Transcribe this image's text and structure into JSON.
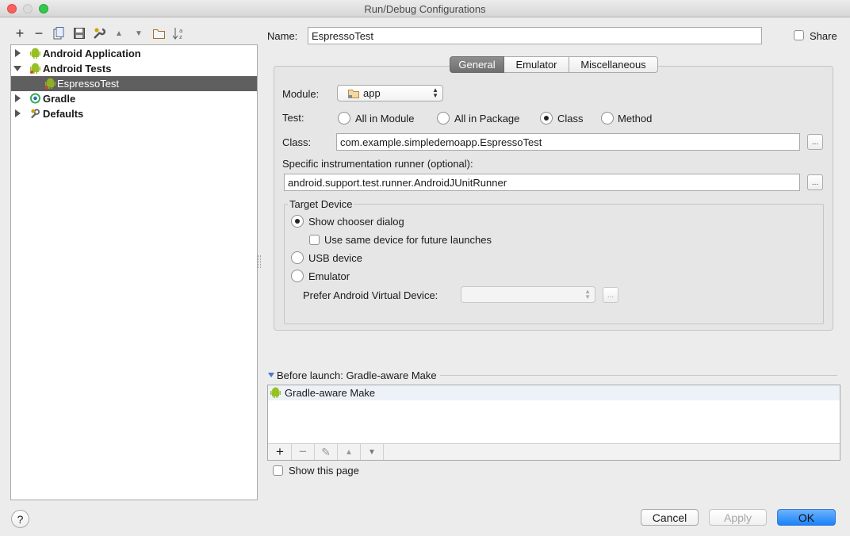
{
  "window": {
    "title": "Run/Debug Configurations"
  },
  "toolbar": {
    "add": "+",
    "remove": "−",
    "copy_icon": "copy-icon",
    "save_icon": "save-icon",
    "edit_defaults_icon": "wrench-icon",
    "move_up": "▲",
    "move_down": "▼",
    "folder_icon": "folder-icon",
    "sort_icon": "sort-icon"
  },
  "tree": {
    "items": [
      {
        "label": "Android Application"
      },
      {
        "label": "Android Tests"
      },
      {
        "label": "EspressoTest"
      },
      {
        "label": "Gradle"
      },
      {
        "label": "Defaults"
      }
    ]
  },
  "config": {
    "name_label": "Name:",
    "name_value": "EspressoTest",
    "share_label": "Share",
    "tabs": [
      {
        "label": "General"
      },
      {
        "label": "Emulator"
      },
      {
        "label": "Miscellaneous"
      }
    ],
    "module_label": "Module:",
    "module_value": "app",
    "test_label": "Test:",
    "test_options": [
      {
        "label": "All in Module"
      },
      {
        "label": "All in Package"
      },
      {
        "label": "Class"
      },
      {
        "label": "Method"
      }
    ],
    "test_selected": "Class",
    "class_label": "Class:",
    "class_value": "com.example.simpledemoapp.EspressoTest",
    "runner_label": "Specific instrumentation runner (optional):",
    "runner_value": "android.support.test.runner.AndroidJUnitRunner",
    "browse_label": "...",
    "target": {
      "title": "Target Device",
      "show_chooser": "Show chooser dialog",
      "same_device": "Use same device for future launches",
      "usb": "USB device",
      "emulator": "Emulator",
      "prefer_avd_label": "Prefer Android Virtual Device:",
      "prefer_avd_value": "",
      "selected": "Show chooser dialog"
    }
  },
  "before_launch": {
    "title": "Before launch: Gradle-aware Make",
    "items": [
      {
        "label": "Gradle-aware Make"
      }
    ],
    "controls": [
      "+",
      "−",
      "✎",
      "▲",
      "▼"
    ],
    "show_page_label": "Show this page"
  },
  "footer": {
    "help": "?",
    "cancel": "Cancel",
    "apply": "Apply",
    "ok": "OK"
  },
  "colors": {
    "selection": "#5f5f5f",
    "android_green": "#97c024",
    "default_button": "#1a82fb"
  }
}
